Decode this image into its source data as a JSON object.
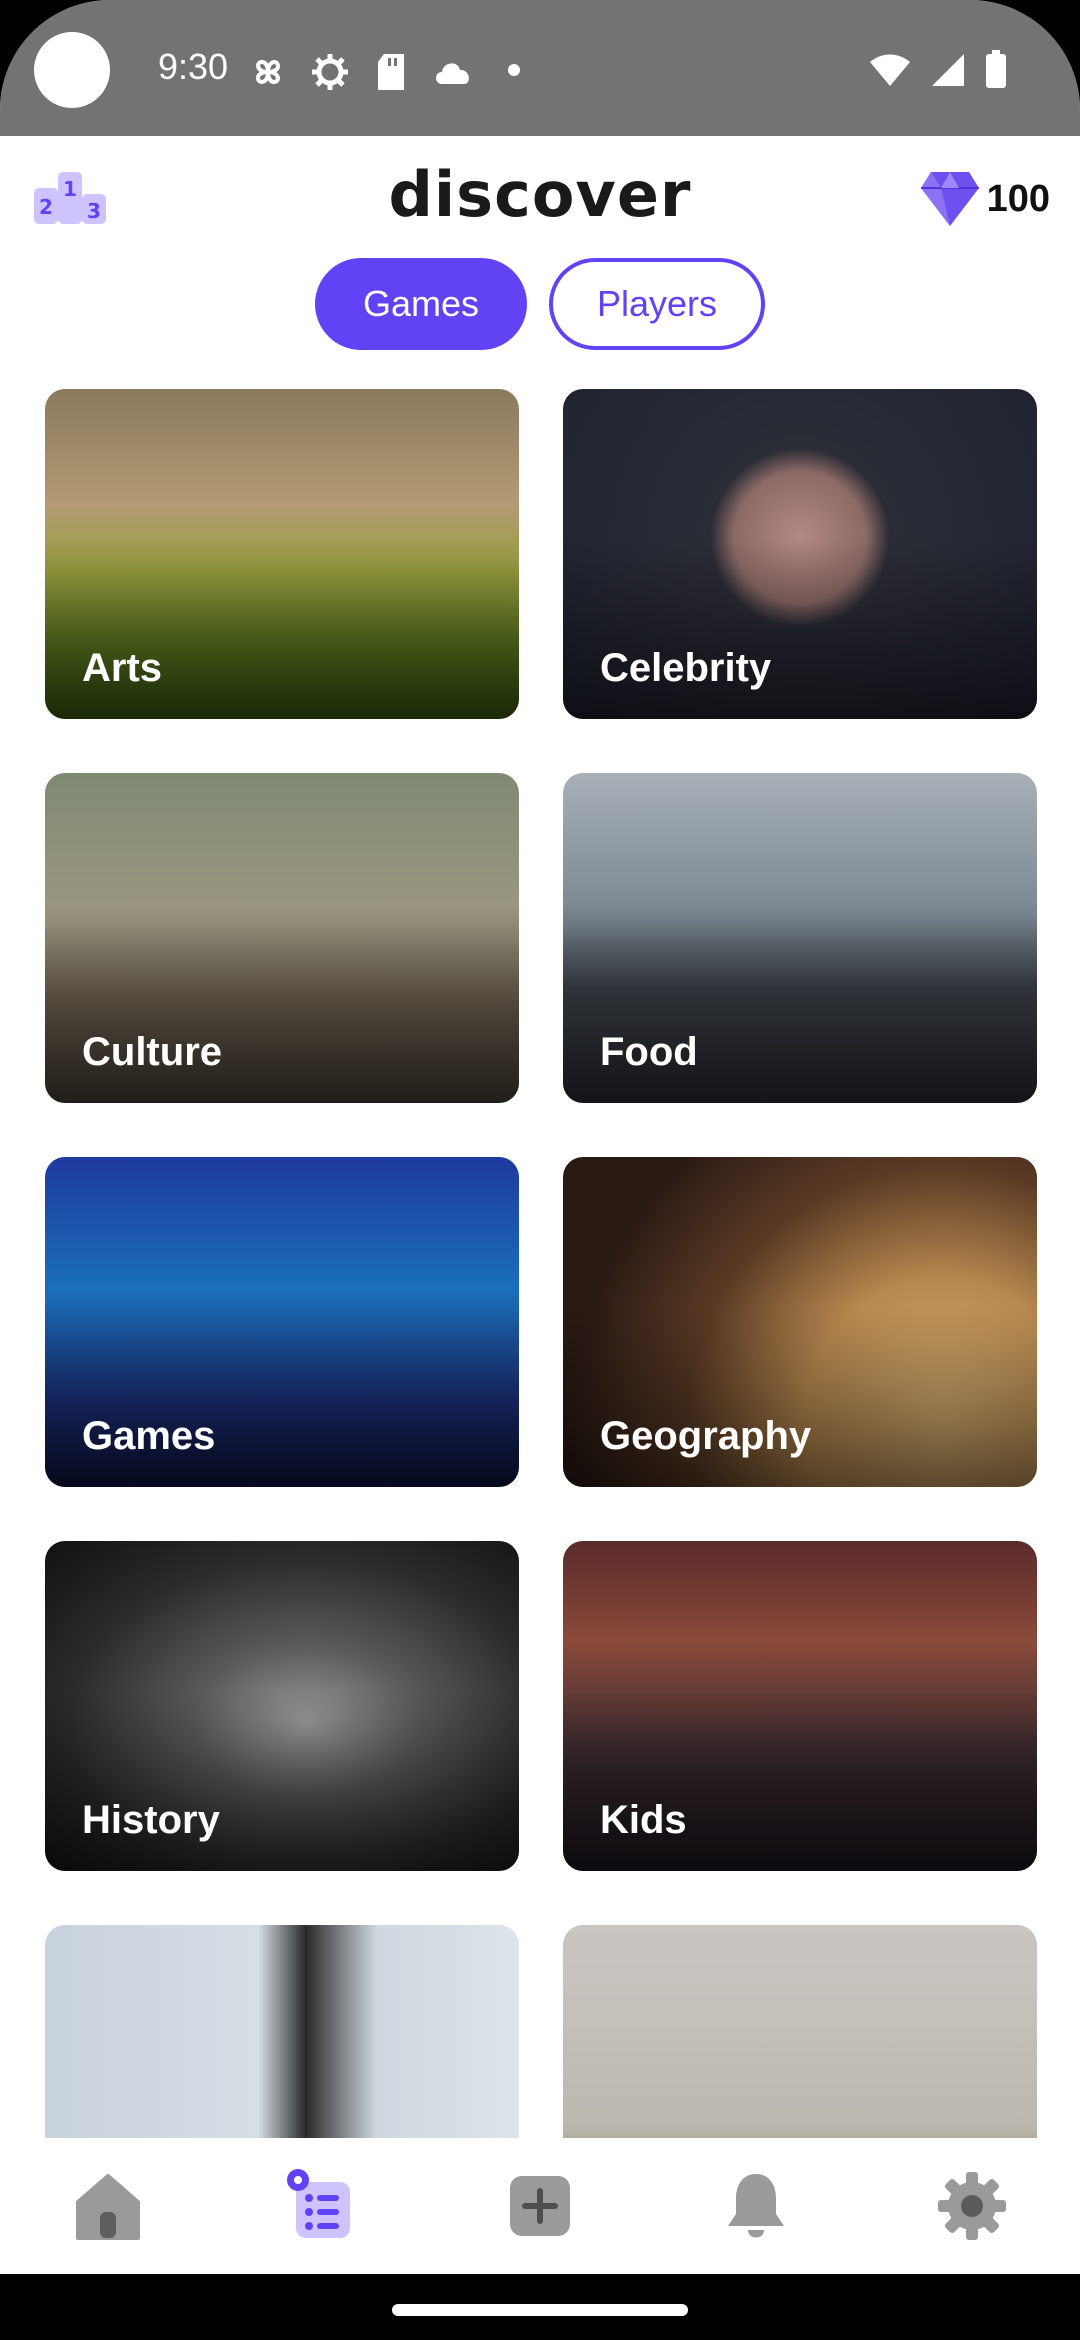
{
  "status_bar": {
    "time": "9:30"
  },
  "header": {
    "title": "discover",
    "gems_count": "100"
  },
  "tabs": [
    {
      "label": "Games",
      "active": true
    },
    {
      "label": "Players",
      "active": false
    }
  ],
  "categories": [
    {
      "label": "Arts"
    },
    {
      "label": "Celebrity"
    },
    {
      "label": "Culture"
    },
    {
      "label": "Food"
    },
    {
      "label": "Games"
    },
    {
      "label": "Geography"
    },
    {
      "label": "History"
    },
    {
      "label": "Kids"
    },
    {
      "label": ""
    },
    {
      "label": ""
    }
  ],
  "bottom_nav": [
    "home-icon",
    "list-icon",
    "add-icon",
    "bell-icon",
    "settings-icon"
  ],
  "colors": {
    "accent": "#6142f5",
    "status_bar": "#737373",
    "icon_gray": "#9a9a9a"
  }
}
